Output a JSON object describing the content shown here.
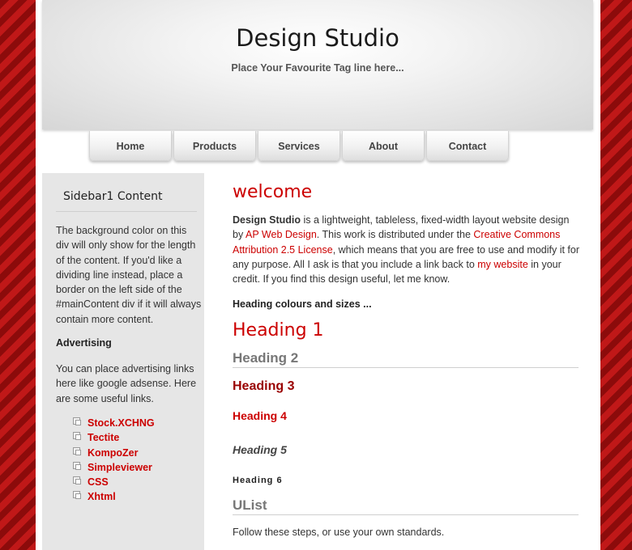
{
  "header": {
    "title": "Design Studio",
    "tagline": "Place Your Favourite Tag line here..."
  },
  "nav": {
    "items": [
      {
        "label": "Home"
      },
      {
        "label": "Products"
      },
      {
        "label": "Services"
      },
      {
        "label": "About"
      },
      {
        "label": "Contact"
      }
    ]
  },
  "sidebar": {
    "title": "Sidebar1 Content",
    "text": "The background color on this div will only show for the length of the content. If you'd like a dividing line instead, place a border on the left side of the #mainContent div if it will always contain more content.",
    "advertising_title": "Advertising",
    "advertising_text": "You can place advertising links here like google adsense. Here are some useful links.",
    "links": [
      {
        "label": "Stock.XCHNG"
      },
      {
        "label": "Tectite"
      },
      {
        "label": "KompoZer"
      },
      {
        "label": "Simpleviewer"
      },
      {
        "label": "CSS"
      },
      {
        "label": "Xhtml"
      }
    ]
  },
  "main": {
    "welcome": "welcome",
    "intro": {
      "brand": "Design Studio",
      "text1": " is a lightweight, tableless, fixed-width layout website design by ",
      "link1": "AP Web Design",
      "text2": ". This work is distributed under the ",
      "link2": "Creative Commons Attribution 2.5 License",
      "text3": ", which means that you are free to use and modify it for any purpose. All I ask is that you include a link back to ",
      "link3": "my website",
      "text4": " in your credit. If you find this design useful, let me know."
    },
    "heading_colours_label": "Heading colours and sizes ...",
    "h1": "Heading 1",
    "h2": "Heading 2",
    "h3": "Heading 3",
    "h4": "Heading 4",
    "h5": "Heading 5",
    "h6": "Heading 6",
    "ulist_heading": "UList",
    "ulist_text": "Follow these steps, or use your own standards."
  },
  "colors": {
    "accent": "#cc0000",
    "dark_red": "#990000",
    "stripe_dark": "#8c0b0b",
    "stripe_light": "#c01818"
  }
}
